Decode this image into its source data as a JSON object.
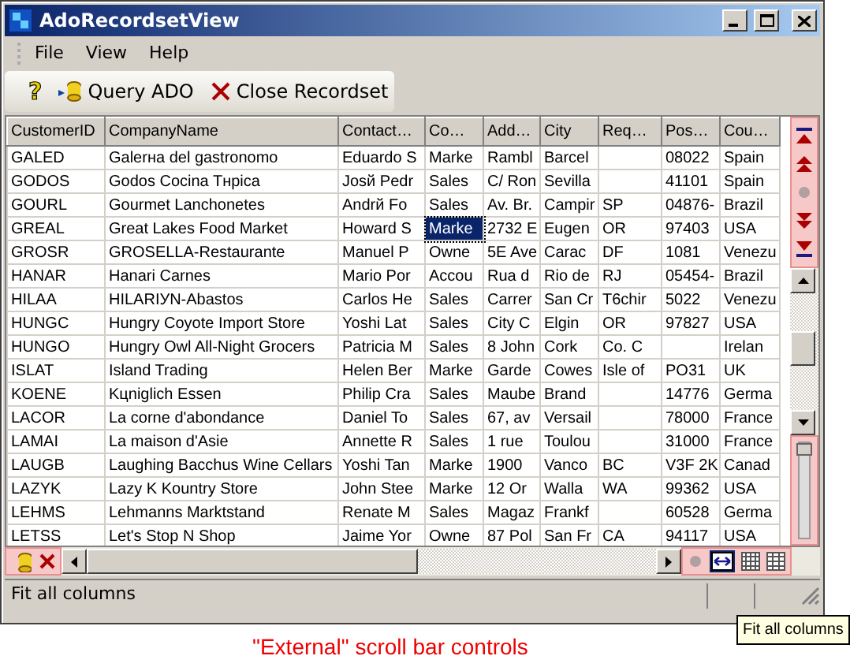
{
  "window": {
    "title": "AdoRecordsetView"
  },
  "menu": [
    "File",
    "View",
    "Help"
  ],
  "toolbar": {
    "help_glyph": "?",
    "buttons": [
      {
        "kind": "query",
        "label": "Query ADO"
      },
      {
        "kind": "close",
        "label": "Close Recordset"
      }
    ]
  },
  "table": {
    "columns": [
      "CustomerID",
      "CompanyName",
      "Contact…",
      "Co…",
      "Add…",
      "City",
      "Req…",
      "Pos…",
      "Cou…"
    ],
    "rows": [
      [
        "GALED",
        "Galerнa del gastronomo",
        "Eduardo S",
        "Marke",
        "Rambl",
        "Barcel",
        "",
        "08022",
        "Spain"
      ],
      [
        "GODOS",
        "Godos Cocina Tнpica",
        "Josй Pedr",
        "Sales",
        "C/ Ron",
        "Sevilla",
        "",
        "41101",
        "Spain"
      ],
      [
        "GOURL",
        "Gourmet Lanchonetes",
        "Andrй Fo",
        "Sales",
        "Av. Br.",
        "Campir",
        "SP",
        "04876-",
        "Brazil"
      ],
      [
        "GREAL",
        "Great Lakes Food Market",
        "Howard S",
        {
          "text": "Marke",
          "focused": true
        },
        "2732 E",
        "Eugen",
        "OR",
        "97403",
        "USA"
      ],
      [
        "GROSR",
        "GROSELLA-Restaurante",
        "Manuel P",
        "Owne",
        "5E Ave",
        "Carac",
        "DF",
        "1081",
        "Venezu"
      ],
      [
        "HANAR",
        "Hanari Carnes",
        "Mario Por",
        "Accou",
        "Rua d",
        "Rio de",
        "RJ",
        "05454-",
        "Brazil"
      ],
      [
        "HILAA",
        "HILARIУN-Abastos",
        "Carlos He",
        "Sales",
        "Carrer",
        "San Cr",
        "T6chir",
        "5022",
        "Venezu"
      ],
      [
        "HUNGC",
        "Hungry Coyote Import Store",
        "Yoshi Lat",
        "Sales",
        "City C",
        "Elgin",
        "OR",
        "97827",
        "USA"
      ],
      [
        "HUNGO",
        "Hungry Owl All-Night Grocers",
        "Patricia M",
        "Sales",
        "8 John",
        "Cork",
        "Co. C",
        "",
        "Irelan"
      ],
      [
        "ISLAT",
        "Island Trading",
        "Helen Ber",
        "Marke",
        "Garde",
        "Cowes",
        "Isle of",
        "PO31",
        "UK"
      ],
      [
        "KOENE",
        "Kцniglich Essen",
        "Philip Cra",
        "Sales",
        "Maube",
        "Brand",
        "",
        "14776",
        "Germa"
      ],
      [
        "LACOR",
        "La corne d'abondance",
        "Daniel To",
        "Sales",
        "67, av",
        "Versail",
        "",
        "78000",
        "France"
      ],
      [
        "LAMAI",
        "La maison d'Asie",
        "Annette R",
        "Sales",
        "1 rue",
        "Toulou",
        "",
        "31000",
        "France"
      ],
      [
        "LAUGB",
        "Laughing Bacchus Wine Cellars",
        "Yoshi Tan",
        "Marke",
        "1900",
        "Vanco",
        "BC",
        "V3F 2K",
        "Canad"
      ],
      [
        "LAZYK",
        "Lazy K Kountry Store",
        "John Stee",
        "Marke",
        "12 Or",
        "Walla",
        "WA",
        "99362",
        "USA"
      ],
      [
        "LEHMS",
        "Lehmanns Marktstand",
        "Renate M",
        "Sales",
        "Magaz",
        "Frankf",
        "",
        "60528",
        "Germa"
      ],
      [
        "LETSS",
        "Let's Stop N Shop",
        "Jaime Yor",
        "Owne",
        "87 Pol",
        "San Fr",
        "CA",
        "94117",
        "USA"
      ]
    ]
  },
  "fit_columns_button": {
    "selected": true
  },
  "status_bar": "Fit all columns",
  "tooltip": "Fit all columns",
  "caption": "\"External\" scroll bar controls"
}
